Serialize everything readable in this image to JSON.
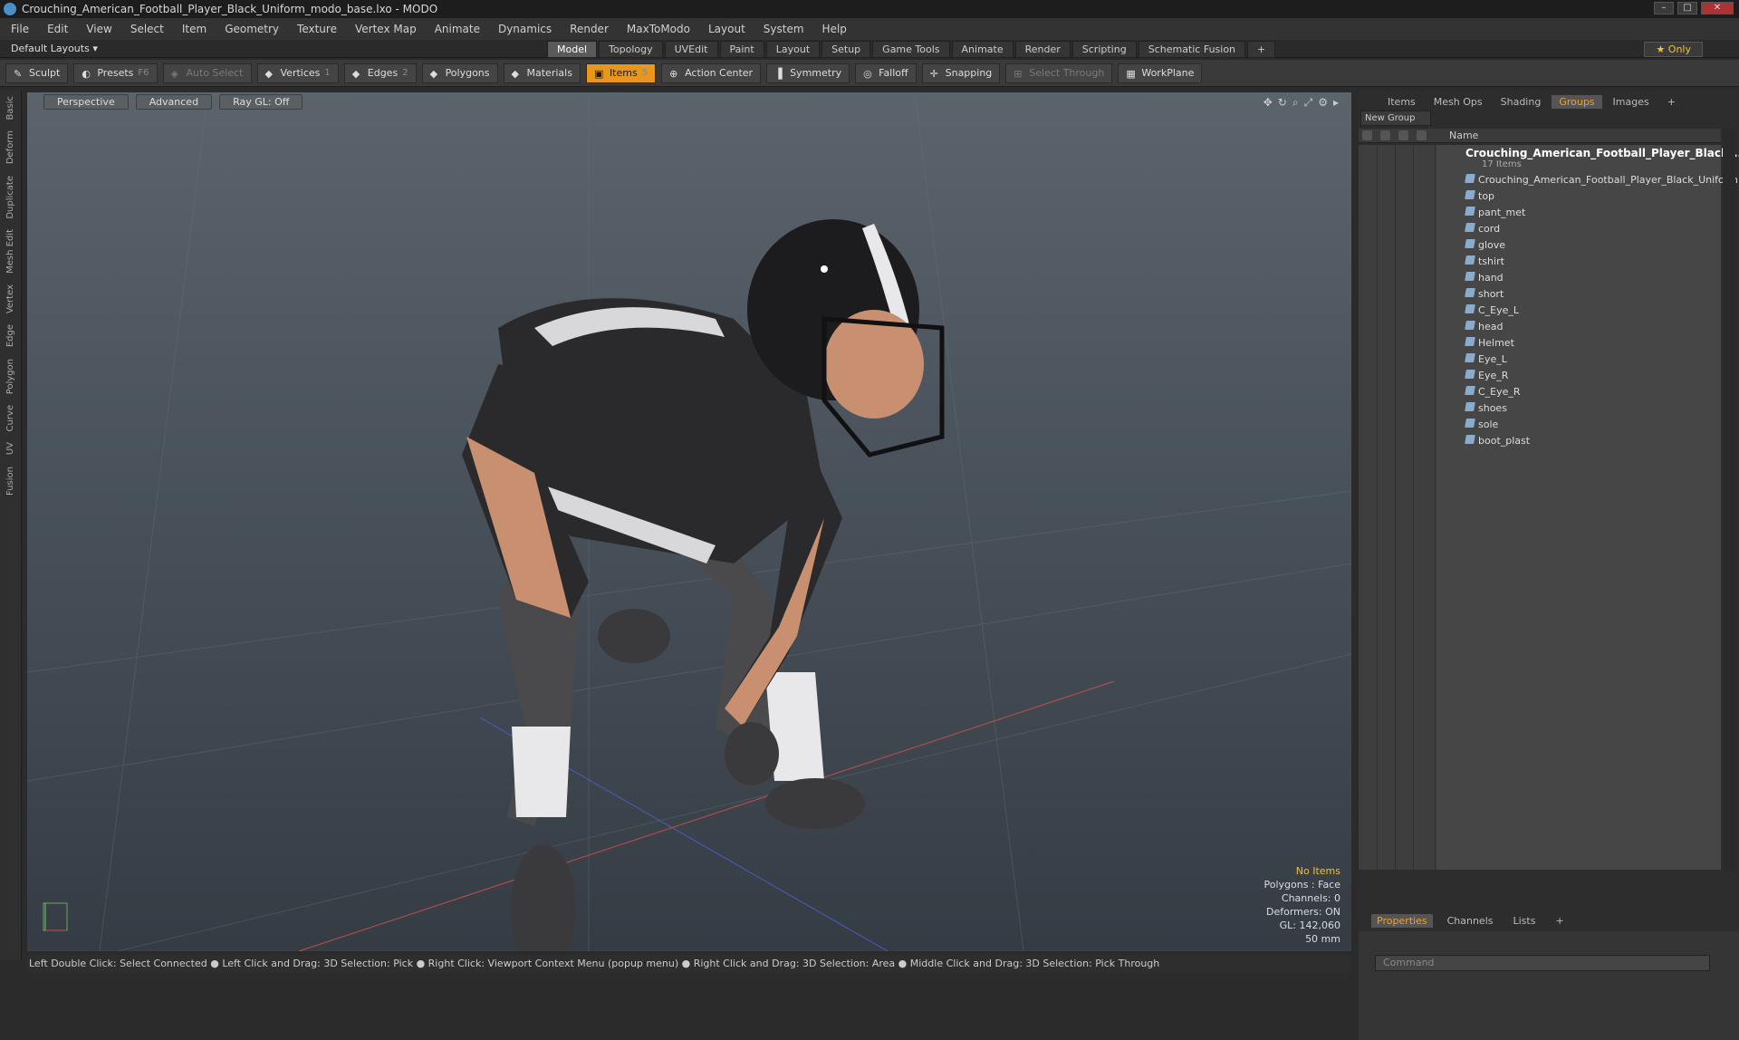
{
  "title": "Crouching_American_Football_Player_Black_Uniform_modo_base.lxo - MODO",
  "menu": [
    "File",
    "Edit",
    "View",
    "Select",
    "Item",
    "Geometry",
    "Texture",
    "Vertex Map",
    "Animate",
    "Dynamics",
    "Render",
    "MaxToModo",
    "Layout",
    "System",
    "Help"
  ],
  "layout_selector": "Default Layouts",
  "layout_tabs": [
    "Model",
    "Topology",
    "UVEdit",
    "Paint",
    "Layout",
    "Setup",
    "Game Tools",
    "Animate",
    "Render",
    "Scripting",
    "Schematic Fusion"
  ],
  "active_layout_tab": "Model",
  "only_label": "Only",
  "toolbar": {
    "sculpt": "Sculpt",
    "presets": "Presets",
    "presets_key": "F6",
    "auto_select": "Auto Select",
    "vertices": "Vertices",
    "vertices_count": "1",
    "edges": "Edges",
    "edges_count": "2",
    "polygons": "Polygons",
    "materials": "Materials",
    "items": "Items",
    "items_count": "5",
    "action_center": "Action Center",
    "symmetry": "Symmetry",
    "falloff": "Falloff",
    "snapping": "Snapping",
    "select_through": "Select Through",
    "workplane": "WorkPlane"
  },
  "left_tabs": [
    "Basic",
    "Deform",
    "Duplicate",
    "Mesh Edit",
    "Vertex",
    "Edge",
    "Polygon",
    "Curve",
    "UV",
    "Fusion"
  ],
  "viewport": {
    "view": "Perspective",
    "shading": "Advanced",
    "raygl": "Ray GL: Off"
  },
  "stats": {
    "items": "No Items",
    "polygons": "Polygons : Face",
    "channels": "Channels: 0",
    "deformers": "Deformers: ON",
    "gl": "GL: 142,060",
    "focal": "50 mm"
  },
  "status_bar": "Left Double Click: Select Connected ● Left Click and Drag: 3D Selection: Pick ● Right Click: Viewport Context Menu (popup menu) ● Right Click and Drag: 3D Selection: Area ● Middle Click and Drag: 3D Selection: Pick Through",
  "right_tabs": [
    "Items",
    "Mesh Ops",
    "Shading",
    "Groups",
    "Images"
  ],
  "active_right_tab": "Groups",
  "new_group": "New Group",
  "tree": {
    "name_header": "Name",
    "group_name": "Crouching_American_Football_Player_Black_...",
    "group_count": "17 Items",
    "items": [
      "Crouching_American_Football_Player_Black_Uniform",
      "top",
      "pant_met",
      "cord",
      "glove",
      "tshirt",
      "hand",
      "short",
      "C_Eye_L",
      "head",
      "Helmet",
      "Eye_L",
      "Eye_R",
      "C_Eye_R",
      "shoes",
      "sole",
      "boot_plast"
    ]
  },
  "bottom_tabs": [
    "Properties",
    "Channels",
    "Lists"
  ],
  "active_bottom_tab": "Properties",
  "command_placeholder": "Command"
}
